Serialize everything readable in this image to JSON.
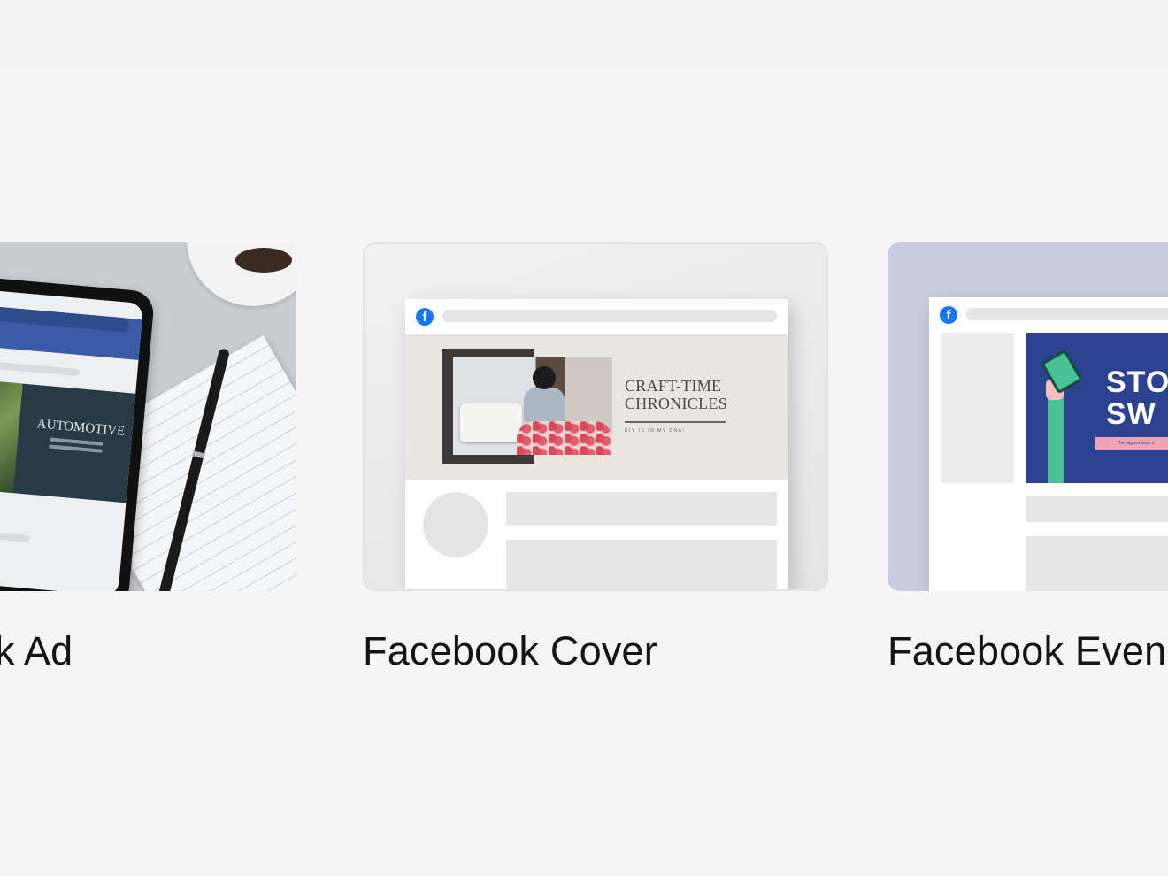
{
  "cards": [
    {
      "label": "k Ad",
      "mockup": {
        "brand_text": "AUTOMOTIVE"
      }
    },
    {
      "label": "Facebook Cover",
      "mockup": {
        "title": "CRAFT-TIME\nCHRONICLES",
        "subtitle": "DIY IS IN MY DNA!",
        "fb_icon": "f"
      }
    },
    {
      "label": "Facebook Even",
      "mockup": {
        "title": "STO\nSW",
        "strip_text": "The biggest book e",
        "fb_icon": "f"
      }
    }
  ],
  "colors": {
    "background": "#f5f5f5",
    "facebook_blue": "#1877f2",
    "event_poster": "#2c4190",
    "label_text": "#141414"
  },
  "icons": [
    "facebook-icon"
  ]
}
